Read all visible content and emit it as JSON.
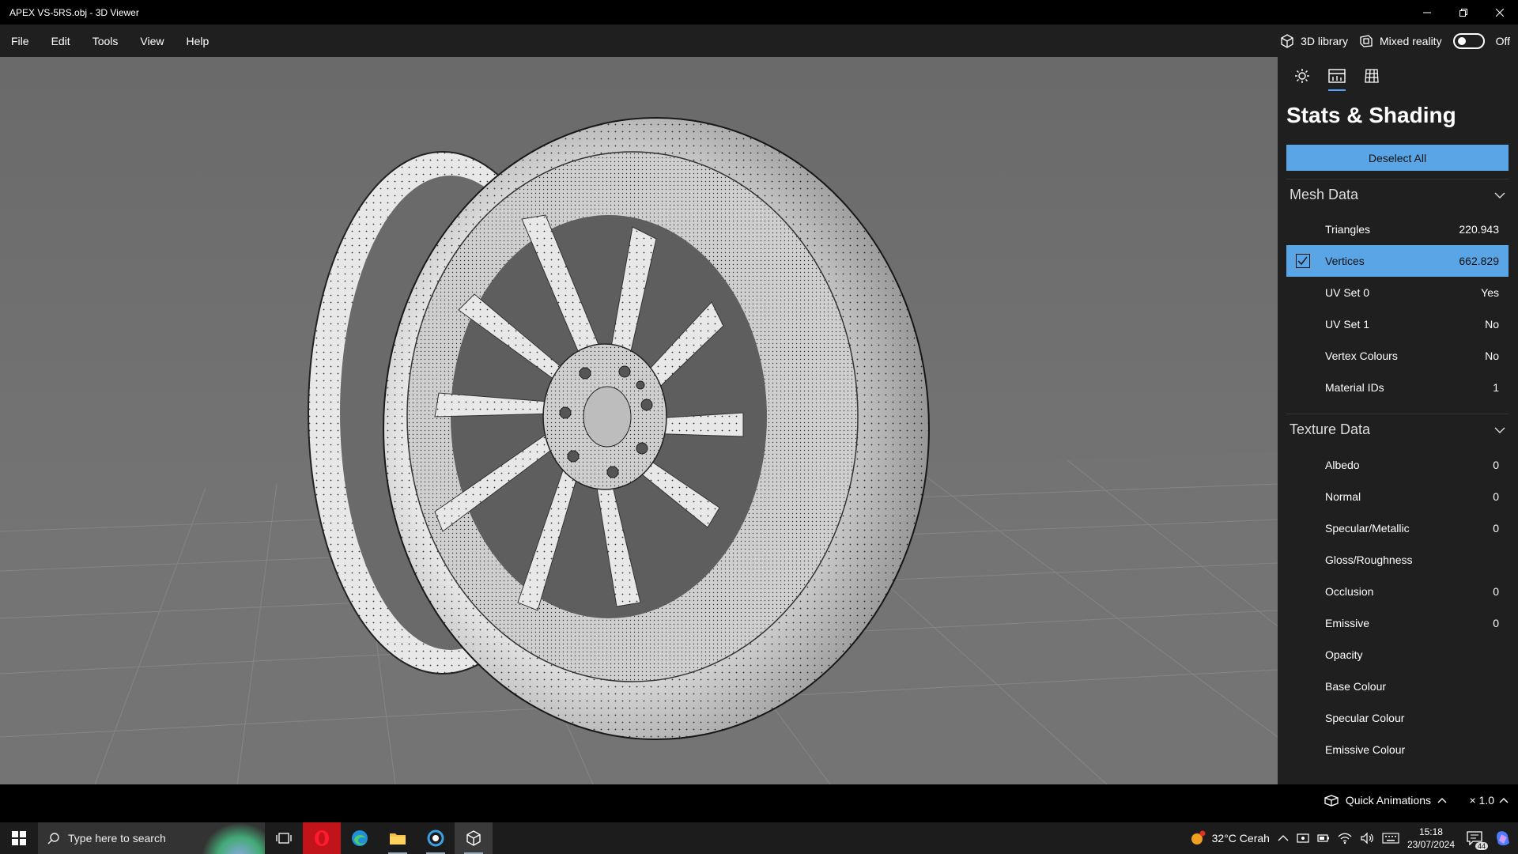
{
  "window": {
    "title": "APEX VS-5RS.obj - 3D Viewer"
  },
  "menu": {
    "items": [
      "File",
      "Edit",
      "Tools",
      "View",
      "Help"
    ]
  },
  "topright": {
    "library_label": "3D library",
    "mixed_reality_label": "Mixed reality",
    "toggle_state": "Off"
  },
  "panel": {
    "title": "Stats & Shading",
    "deselect_label": "Deselect All",
    "mesh_header": "Mesh Data",
    "mesh_rows": [
      {
        "label": "Triangles",
        "value": "220.943"
      },
      {
        "label": "Vertices",
        "value": "662.829",
        "selected": true
      },
      {
        "label": "UV Set 0",
        "value": "Yes"
      },
      {
        "label": "UV Set 1",
        "value": "No"
      },
      {
        "label": "Vertex Colours",
        "value": "No"
      },
      {
        "label": "Material IDs",
        "value": "1"
      }
    ],
    "texture_header": "Texture Data",
    "texture_rows": [
      {
        "label": "Albedo",
        "value": "0"
      },
      {
        "label": "Normal",
        "value": "0"
      },
      {
        "label": "Specular/Metallic",
        "value": "0"
      },
      {
        "label": "Gloss/Roughness",
        "value": ""
      },
      {
        "label": "Occlusion",
        "value": "0"
      },
      {
        "label": "Emissive",
        "value": "0"
      },
      {
        "label": "Opacity",
        "value": ""
      },
      {
        "label": "Base Colour",
        "value": ""
      },
      {
        "label": "Specular Colour",
        "value": ""
      },
      {
        "label": "Emissive Colour",
        "value": ""
      }
    ]
  },
  "status": {
    "quick_animations": "Quick Animations",
    "speed": "× 1.0"
  },
  "taskbar": {
    "search_placeholder": "Type here to search",
    "weather": "32°C  Cerah",
    "time": "15:18",
    "date": "23/07/2024",
    "notification_count": "44"
  },
  "colors": {
    "accent": "#5aa5e6",
    "viewport_bg": "#6e6e6e",
    "panel_bg": "#1f1f1f"
  }
}
